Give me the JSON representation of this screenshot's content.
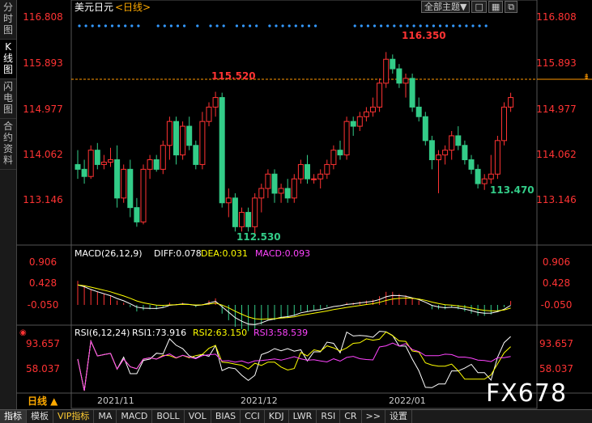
{
  "side_tabs": [
    {
      "label": [
        "分",
        "时",
        "图"
      ],
      "active": false
    },
    {
      "label": [
        "K",
        "线",
        "图"
      ],
      "active": true
    },
    {
      "label": [
        "闪",
        "电",
        "图"
      ],
      "active": false
    },
    {
      "label": [
        "合",
        "约",
        "资",
        "料"
      ],
      "active": false
    }
  ],
  "header": {
    "title": "美元日元",
    "period": "<日线>",
    "theme_button": "全部主题▼",
    "icons": [
      "square-icon",
      "grid-icon",
      "restore-icon"
    ]
  },
  "price_axis": [
    "116.808",
    "115.893",
    "114.977",
    "114.062",
    "113.146"
  ],
  "current_price_marker": "115.520",
  "annotations": {
    "high_label": "116.350",
    "low_label": "112.530",
    "right_low_label": "113.470",
    "mid_label": "115.520"
  },
  "macd": {
    "title": "MACD(26,12,9)",
    "diff_label": "DIFF:0.078",
    "dea_label": "DEA:0.031",
    "macd_label": "MACD:0.093",
    "axis": [
      "0.906",
      "0.428",
      "-0.050"
    ]
  },
  "rsi": {
    "title": "RSI(6,12,24)",
    "rsi1_label": "RSI1:73.916",
    "rsi2_label": "RSI2:63.150",
    "rsi3_label": "RSI3:58.539",
    "axis": [
      "93.657",
      "58.037"
    ]
  },
  "time_axis": {
    "period_label": "日线 ▲",
    "months": [
      "2021/11",
      "2021/12",
      "2022/01"
    ]
  },
  "bottom_tabs": [
    "指标",
    "模板",
    "VIP指标",
    "MA",
    "MACD",
    "BOLL",
    "VOL",
    "BIAS",
    "CCI",
    "KDJ",
    "LWR",
    "RSI",
    "CR",
    ">>",
    "设置"
  ],
  "watermark": "FX678",
  "colors": {
    "up": "#ff3333",
    "down": "#33cc88",
    "axis_text": "#ff4444",
    "diff": "#ffffff",
    "dea": "#ffff00",
    "macd": "#ff44ff"
  },
  "chart_data": {
    "type": "candlestick",
    "ylim": [
      112.3,
      117.1
    ],
    "candles": [
      {
        "o": 114.0,
        "h": 114.3,
        "l": 113.7,
        "c": 113.9
      },
      {
        "o": 113.9,
        "h": 114.1,
        "l": 113.6,
        "c": 113.75
      },
      {
        "o": 113.75,
        "h": 114.4,
        "l": 113.7,
        "c": 114.3
      },
      {
        "o": 114.3,
        "h": 114.45,
        "l": 113.9,
        "c": 114.0
      },
      {
        "o": 114.0,
        "h": 114.2,
        "l": 113.9,
        "c": 114.05
      },
      {
        "o": 114.05,
        "h": 114.35,
        "l": 113.95,
        "c": 114.1
      },
      {
        "o": 114.1,
        "h": 114.4,
        "l": 113.1,
        "c": 113.3
      },
      {
        "o": 113.3,
        "h": 114.0,
        "l": 113.2,
        "c": 113.9
      },
      {
        "o": 113.9,
        "h": 114.1,
        "l": 112.9,
        "c": 113.1
      },
      {
        "o": 113.1,
        "h": 113.3,
        "l": 112.7,
        "c": 112.8
      },
      {
        "o": 112.8,
        "h": 114.0,
        "l": 112.75,
        "c": 113.9
      },
      {
        "o": 113.9,
        "h": 114.2,
        "l": 113.7,
        "c": 114.1
      },
      {
        "o": 114.1,
        "h": 114.2,
        "l": 113.85,
        "c": 113.9
      },
      {
        "o": 113.9,
        "h": 114.5,
        "l": 113.8,
        "c": 114.4
      },
      {
        "o": 114.4,
        "h": 115.0,
        "l": 114.1,
        "c": 114.9
      },
      {
        "o": 114.9,
        "h": 115.0,
        "l": 114.0,
        "c": 114.2
      },
      {
        "o": 114.2,
        "h": 114.9,
        "l": 114.1,
        "c": 114.8
      },
      {
        "o": 114.8,
        "h": 115.0,
        "l": 114.3,
        "c": 114.4
      },
      {
        "o": 114.4,
        "h": 114.5,
        "l": 113.9,
        "c": 114.0
      },
      {
        "o": 114.0,
        "h": 115.1,
        "l": 113.9,
        "c": 114.9
      },
      {
        "o": 114.9,
        "h": 115.3,
        "l": 114.8,
        "c": 115.2
      },
      {
        "o": 115.2,
        "h": 115.52,
        "l": 115.0,
        "c": 115.4
      },
      {
        "o": 115.4,
        "h": 115.5,
        "l": 113.1,
        "c": 113.2
      },
      {
        "o": 113.2,
        "h": 113.5,
        "l": 112.9,
        "c": 113.3
      },
      {
        "o": 113.3,
        "h": 113.4,
        "l": 112.6,
        "c": 112.7
      },
      {
        "o": 112.7,
        "h": 113.1,
        "l": 112.6,
        "c": 113.0
      },
      {
        "o": 113.0,
        "h": 113.1,
        "l": 112.6,
        "c": 112.7
      },
      {
        "o": 112.7,
        "h": 113.4,
        "l": 112.53,
        "c": 113.3
      },
      {
        "o": 113.3,
        "h": 113.6,
        "l": 113.0,
        "c": 113.5
      },
      {
        "o": 113.5,
        "h": 113.9,
        "l": 113.3,
        "c": 113.8
      },
      {
        "o": 113.8,
        "h": 113.9,
        "l": 113.2,
        "c": 113.4
      },
      {
        "o": 113.4,
        "h": 113.6,
        "l": 113.2,
        "c": 113.5
      },
      {
        "o": 113.5,
        "h": 113.7,
        "l": 113.2,
        "c": 113.3
      },
      {
        "o": 113.3,
        "h": 113.8,
        "l": 113.2,
        "c": 113.7
      },
      {
        "o": 113.7,
        "h": 114.1,
        "l": 113.6,
        "c": 114.0
      },
      {
        "o": 114.0,
        "h": 114.2,
        "l": 113.6,
        "c": 113.7
      },
      {
        "o": 113.7,
        "h": 113.8,
        "l": 113.6,
        "c": 113.7
      },
      {
        "o": 113.7,
        "h": 113.9,
        "l": 113.5,
        "c": 113.8
      },
      {
        "o": 113.8,
        "h": 114.1,
        "l": 113.7,
        "c": 114.0
      },
      {
        "o": 114.0,
        "h": 114.4,
        "l": 113.9,
        "c": 114.3
      },
      {
        "o": 114.3,
        "h": 114.5,
        "l": 114.1,
        "c": 114.2
      },
      {
        "o": 114.2,
        "h": 115.0,
        "l": 114.1,
        "c": 114.9
      },
      {
        "o": 114.9,
        "h": 115.0,
        "l": 114.6,
        "c": 114.8
      },
      {
        "o": 114.8,
        "h": 115.1,
        "l": 114.7,
        "c": 115.0
      },
      {
        "o": 115.0,
        "h": 115.2,
        "l": 114.9,
        "c": 115.1
      },
      {
        "o": 115.1,
        "h": 115.4,
        "l": 115.0,
        "c": 115.2
      },
      {
        "o": 115.2,
        "h": 115.8,
        "l": 115.1,
        "c": 115.7
      },
      {
        "o": 115.7,
        "h": 116.35,
        "l": 115.6,
        "c": 116.2
      },
      {
        "o": 116.2,
        "h": 116.3,
        "l": 115.9,
        "c": 116.0
      },
      {
        "o": 116.0,
        "h": 116.1,
        "l": 115.6,
        "c": 115.7
      },
      {
        "o": 115.7,
        "h": 115.9,
        "l": 115.4,
        "c": 115.8
      },
      {
        "o": 115.8,
        "h": 115.9,
        "l": 115.1,
        "c": 115.2
      },
      {
        "o": 115.2,
        "h": 115.4,
        "l": 114.9,
        "c": 115.0
      },
      {
        "o": 115.0,
        "h": 115.1,
        "l": 114.4,
        "c": 114.5
      },
      {
        "o": 114.5,
        "h": 114.6,
        "l": 113.9,
        "c": 114.1
      },
      {
        "o": 114.1,
        "h": 114.3,
        "l": 113.4,
        "c": 114.2
      },
      {
        "o": 114.2,
        "h": 114.4,
        "l": 114.0,
        "c": 114.3
      },
      {
        "o": 114.3,
        "h": 114.7,
        "l": 114.1,
        "c": 114.6
      },
      {
        "o": 114.6,
        "h": 114.8,
        "l": 114.3,
        "c": 114.4
      },
      {
        "o": 114.4,
        "h": 114.5,
        "l": 114.0,
        "c": 114.1
      },
      {
        "o": 114.1,
        "h": 114.2,
        "l": 113.8,
        "c": 113.9
      },
      {
        "o": 113.9,
        "h": 114.0,
        "l": 113.5,
        "c": 113.6
      },
      {
        "o": 113.6,
        "h": 113.8,
        "l": 113.47,
        "c": 113.7
      },
      {
        "o": 113.7,
        "h": 114.2,
        "l": 113.6,
        "c": 113.8
      },
      {
        "o": 113.8,
        "h": 114.6,
        "l": 113.7,
        "c": 114.5
      },
      {
        "o": 114.5,
        "h": 115.3,
        "l": 114.4,
        "c": 115.2
      },
      {
        "o": 115.2,
        "h": 115.5,
        "l": 115.1,
        "c": 115.4
      }
    ],
    "macd_values": [
      0.55,
      0.45,
      0.35,
      0.3,
      0.25,
      0.2,
      0.1,
      0.05,
      -0.05,
      -0.15,
      -0.12,
      -0.1,
      -0.1,
      -0.05,
      0.05,
      0.02,
      0.05,
      0.0,
      -0.05,
      0.02,
      0.1,
      0.15,
      -0.2,
      -0.35,
      -0.5,
      -0.55,
      -0.6,
      -0.55,
      -0.45,
      -0.35,
      -0.35,
      -0.3,
      -0.3,
      -0.25,
      -0.15,
      -0.15,
      -0.12,
      -0.1,
      -0.05,
      0.0,
      0.0,
      0.05,
      0.05,
      0.08,
      0.1,
      0.12,
      0.2,
      0.3,
      0.3,
      0.25,
      0.22,
      0.15,
      0.1,
      0.0,
      -0.1,
      -0.1,
      -0.1,
      -0.05,
      -0.1,
      -0.15,
      -0.2,
      -0.25,
      -0.25,
      -0.22,
      -0.15,
      -0.05,
      0.09
    ]
  }
}
